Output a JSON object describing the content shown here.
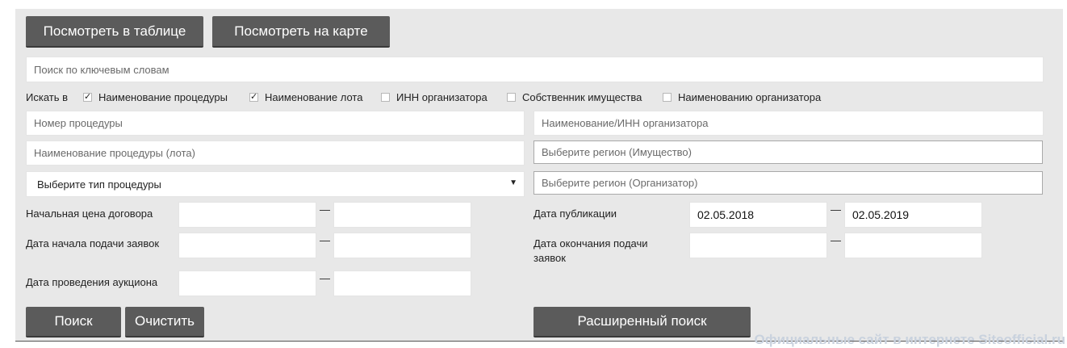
{
  "view_buttons": {
    "table": "Посмотреть в таблице",
    "map": "Посмотреть на карте"
  },
  "keyword_search": {
    "placeholder": "Поиск по ключевым словам",
    "value": ""
  },
  "search_in": {
    "label": "Искать в",
    "options": [
      {
        "label": "Наименование процедуры",
        "checked": true
      },
      {
        "label": "Наименование лота",
        "checked": true
      },
      {
        "label": "ИНН организатора",
        "checked": false
      },
      {
        "label": "Собственник имущества",
        "checked": false
      },
      {
        "label": "Наименованию организатора",
        "checked": false
      }
    ]
  },
  "fields": {
    "procedure_number": "Номер процедуры",
    "procedure_name": "Наименование процедуры (лота)",
    "procedure_type": "Выберите тип процедуры",
    "organizer_name_inn": "Наименование/ИНН организатора",
    "region_property": "Выберите регион (Имущество)",
    "region_organizer": "Выберите регион (Организатор)"
  },
  "ranges": {
    "dash": "—",
    "start_price": {
      "label": "Начальная цена договора",
      "from": "",
      "to": ""
    },
    "application_start": {
      "label": "Дата начала подачи заявок",
      "from": "",
      "to": ""
    },
    "auction_date": {
      "label": "Дата проведения аукциона",
      "from": "",
      "to": ""
    },
    "publication_date": {
      "label": "Дата публикации",
      "from": "02.05.2018",
      "to": "02.05.2019"
    },
    "application_end": {
      "label": "Дата окончания подачи заявок",
      "from": "",
      "to": ""
    }
  },
  "actions": {
    "search": "Поиск",
    "clear": "Очистить",
    "advanced": "Расширенный поиск"
  },
  "watermark": "Официальные сайт в интернете Siteofficial.ru"
}
